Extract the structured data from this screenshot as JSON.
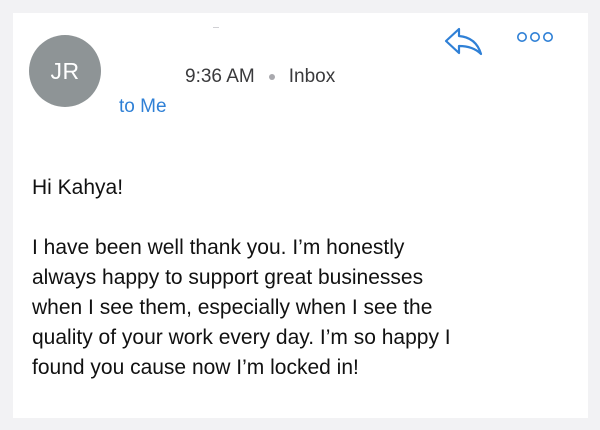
{
  "sender": {
    "initials": "JR",
    "recipient": "to Me"
  },
  "meta": {
    "time": "9:36 AM",
    "mailbox": "Inbox"
  },
  "toolbar": {
    "reply_icon": "reply-arrow-icon",
    "more_icon": "ellipsis-icon"
  },
  "message": {
    "greeting": "Hi Kahya!",
    "body": "I have been well thank you. I’m honestly\nalways happy to support great businesses\nwhen I see them, especially when I see the\nquality of your work every day. I’m so happy I\nfound you cause now I’m locked in!"
  },
  "colors": {
    "accent": "#2f80d6",
    "avatar": "#8e9496",
    "background": "#f2f2f4"
  }
}
